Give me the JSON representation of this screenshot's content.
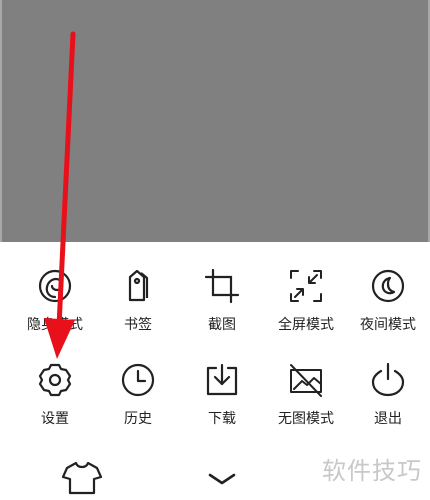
{
  "menu": {
    "row1": [
      {
        "label": "隐身模式",
        "icon": "incognito-icon"
      },
      {
        "label": "书签",
        "icon": "bookmark-tag-icon"
      },
      {
        "label": "截图",
        "icon": "crop-icon"
      },
      {
        "label": "全屏模式",
        "icon": "fullscreen-icon"
      },
      {
        "label": "夜间模式",
        "icon": "moon-icon"
      }
    ],
    "row2": [
      {
        "label": "设置",
        "icon": "gear-icon"
      },
      {
        "label": "历史",
        "icon": "clock-icon"
      },
      {
        "label": "下载",
        "icon": "download-icon"
      },
      {
        "label": "无图模式",
        "icon": "no-image-icon"
      },
      {
        "label": "退出",
        "icon": "power-icon"
      }
    ]
  },
  "bottom_bar": {
    "skin_icon": "tshirt-icon",
    "collapse_icon": "chevron-down-icon"
  },
  "watermark": "软件技巧",
  "colors": {
    "overlay": "#808080",
    "icon_stroke": "#222222",
    "annotation_arrow": "#e8101a"
  }
}
